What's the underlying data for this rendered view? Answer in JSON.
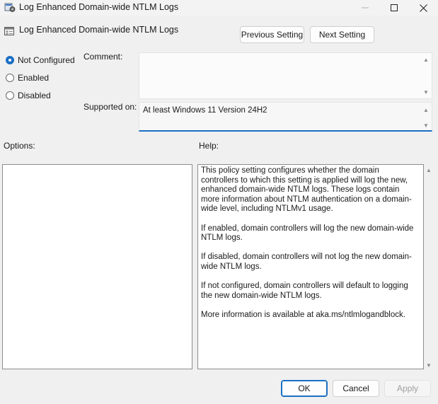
{
  "window": {
    "title": "Log Enhanced Domain-wide NTLM Logs"
  },
  "header": {
    "policy_name": "Log Enhanced Domain-wide NTLM Logs",
    "previous_label": "Previous Setting",
    "next_label": "Next Setting"
  },
  "state": {
    "options": [
      {
        "label": "Not Configured",
        "selected": true
      },
      {
        "label": "Enabled",
        "selected": false
      },
      {
        "label": "Disabled",
        "selected": false
      }
    ]
  },
  "comment": {
    "label": "Comment:",
    "value": ""
  },
  "supported_on": {
    "label": "Supported on:",
    "value": "At least Windows 11 Version 24H2"
  },
  "options_panel": {
    "label": "Options:"
  },
  "help_panel": {
    "label": "Help:",
    "paragraphs": [
      "This policy setting configures whether the domain controllers to which this setting is applied will log the new, enhanced domain-wide NTLM logs. These logs contain more information about NTLM authentication on a domain-wide level, including NTLMv1 usage.",
      "If enabled, domain controllers will log the new domain-wide NTLM logs.",
      "If disabled, domain controllers will not log the new domain-wide NTLM logs.",
      "If not configured, domain controllers will default to logging the new domain-wide NTLM logs.",
      "More information is available at aka.ms/ntlmlogandblock."
    ]
  },
  "footer": {
    "ok_label": "OK",
    "cancel_label": "Cancel",
    "apply_label": "Apply"
  },
  "colors": {
    "accent": "#1a6fc4",
    "background": "#f0f0f0"
  }
}
